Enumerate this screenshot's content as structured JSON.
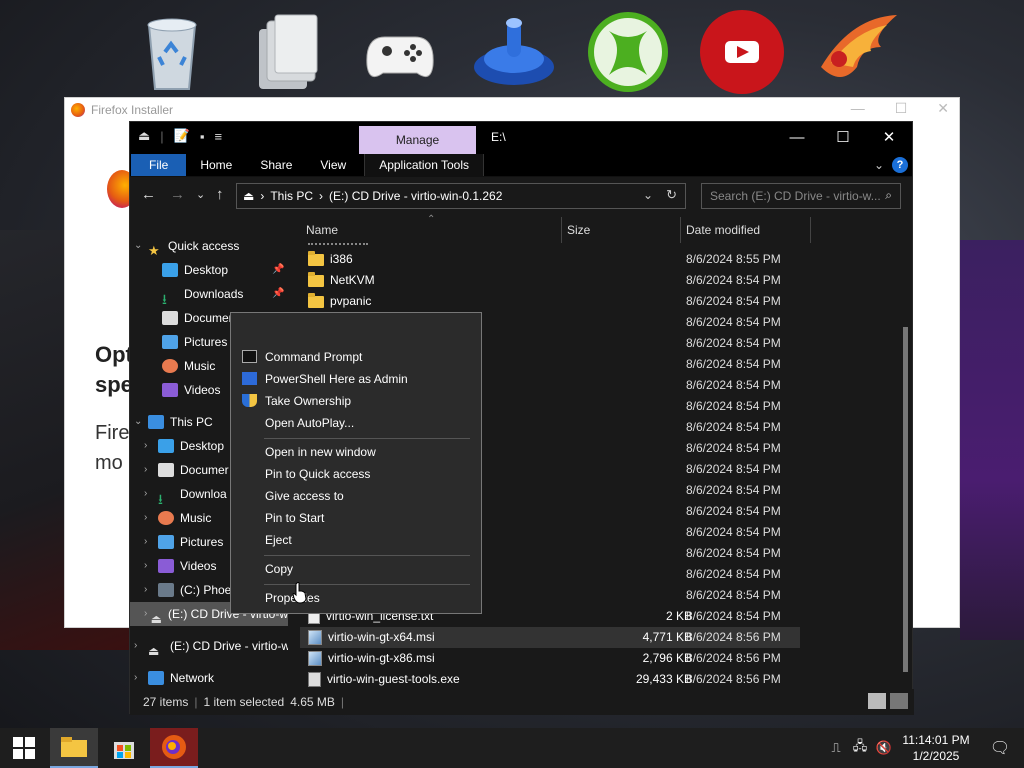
{
  "dock": {
    "items": [
      {
        "name": "recycle-bin-icon"
      },
      {
        "name": "file-cabinet-icon"
      },
      {
        "name": "game-controller-icon"
      },
      {
        "name": "blue-app-icon"
      },
      {
        "name": "xbox-icon"
      },
      {
        "name": "youtube-icon"
      },
      {
        "name": "phoenix-icon"
      }
    ]
  },
  "firefox_installer": {
    "title": "Firefox Installer",
    "heading_line1": "Opt",
    "heading_line2": "spe",
    "body_line1": "Fire",
    "body_line2": "mo"
  },
  "explorer": {
    "manage_tab": "Manage",
    "path_title": "E:\\",
    "ribbon": {
      "file": "File",
      "home": "Home",
      "share": "Share",
      "view": "View",
      "app_tools": "Application Tools"
    },
    "address": {
      "this_pc": "This PC",
      "drive": "(E:) CD Drive - virtio-win-0.1.262"
    },
    "search_placeholder": "Search (E:) CD Drive - virtio-w...",
    "columns": {
      "name": "Name",
      "size": "Size",
      "date": "Date modified"
    },
    "nav": {
      "quick_access": "Quick access",
      "desktop": "Desktop",
      "downloads": "Downloads",
      "documents": "Documer",
      "pictures": "Pictures",
      "music": "Music",
      "videos": "Videos",
      "this_pc": "This PC",
      "pc_desktop": "Desktop",
      "pc_documents": "Documer",
      "pc_downloads": "Downloa",
      "pc_music": "Music",
      "pc_pictures": "Pictures",
      "pc_videos": "Videos",
      "c_drive": "(C:) Phoe",
      "e_drive_sel": "(E:) CD Drive - virtio-w",
      "e_drive": "(E:) CD Drive - virtio-w",
      "network": "Network"
    },
    "rows": [
      {
        "name": "i386",
        "size": "",
        "date": "8/6/2024 8:55 PM",
        "type": "folder"
      },
      {
        "name": "NetKVM",
        "size": "",
        "date": "8/6/2024 8:54 PM",
        "type": "folder"
      },
      {
        "name": "pvpanic",
        "size": "",
        "date": "8/6/2024 8:54 PM",
        "type": "folder"
      },
      {
        "name": "",
        "size": "",
        "date": "8/6/2024 8:54 PM",
        "type": "hidden"
      },
      {
        "name": "",
        "size": "",
        "date": "8/6/2024 8:54 PM",
        "type": "hidden"
      },
      {
        "name": "",
        "size": "",
        "date": "8/6/2024 8:54 PM",
        "type": "hidden"
      },
      {
        "name": "",
        "size": "",
        "date": "8/6/2024 8:54 PM",
        "type": "hidden"
      },
      {
        "name": "",
        "size": "",
        "date": "8/6/2024 8:54 PM",
        "type": "hidden"
      },
      {
        "name": "",
        "size": "",
        "date": "8/6/2024 8:54 PM",
        "type": "hidden"
      },
      {
        "name": "",
        "size": "",
        "date": "8/6/2024 8:54 PM",
        "type": "hidden"
      },
      {
        "name": "",
        "size": "",
        "date": "8/6/2024 8:54 PM",
        "type": "hidden"
      },
      {
        "name": "",
        "size": "",
        "date": "8/6/2024 8:54 PM",
        "type": "hidden"
      },
      {
        "name": "",
        "size": "",
        "date": "8/6/2024 8:54 PM",
        "type": "hidden"
      },
      {
        "name": "",
        "size": "",
        "date": "8/6/2024 8:54 PM",
        "type": "hidden"
      },
      {
        "name": "",
        "size": "",
        "date": "8/6/2024 8:54 PM",
        "type": "hidden"
      },
      {
        "name": "",
        "size": "",
        "date": "8/6/2024 8:54 PM",
        "type": "hidden"
      },
      {
        "name": "",
        "size": "",
        "date": "8/6/2024 8:54 PM",
        "type": "hidden"
      },
      {
        "name": "virtio-win_license.txt",
        "size": "2 KB",
        "date": "8/6/2024 8:54 PM",
        "type": "file"
      },
      {
        "name": "virtio-win-gt-x64.msi",
        "size": "4,771 KB",
        "date": "8/6/2024 8:56 PM",
        "type": "msi"
      },
      {
        "name": "virtio-win-gt-x86.msi",
        "size": "2,796 KB",
        "date": "8/6/2024 8:56 PM",
        "type": "msi"
      },
      {
        "name": "virtio-win-guest-tools.exe",
        "size": "29,433 KB",
        "date": "8/6/2024 8:56 PM",
        "type": "exe"
      }
    ],
    "status": {
      "items": "27 items",
      "selected": "1 item selected",
      "size": "4.65 MB"
    }
  },
  "context_menu": {
    "command_prompt": "Command Prompt",
    "powershell": "PowerShell Here as Admin",
    "take_ownership": "Take Ownership",
    "open_autoplay": "Open AutoPlay...",
    "open_new_window": "Open in new window",
    "pin_quick_access": "Pin to Quick access",
    "give_access": "Give access to",
    "pin_start": "Pin to Start",
    "eject": "Eject",
    "copy": "Copy",
    "properties": "Properties"
  },
  "taskbar": {
    "time": "11:14:01 PM",
    "date": "1/2/2025"
  }
}
